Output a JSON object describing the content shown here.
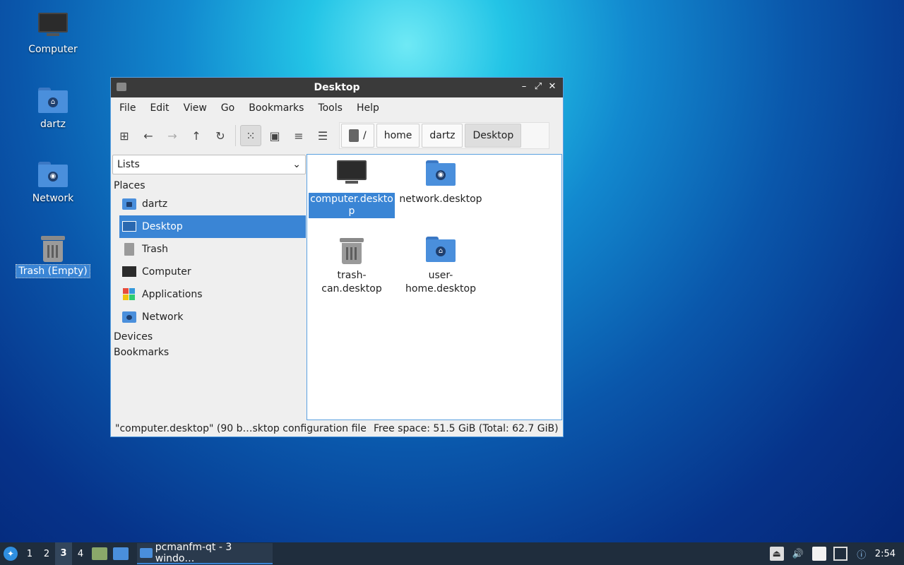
{
  "desktop": {
    "icons": [
      {
        "label": "Computer"
      },
      {
        "label": "dartz"
      },
      {
        "label": "Network"
      },
      {
        "label": "Trash (Empty)"
      }
    ]
  },
  "window": {
    "title": "Desktop",
    "buttons": {
      "minimize": "–",
      "maximize": "⤢",
      "close": "✕"
    }
  },
  "menubar": {
    "items": [
      "File",
      "Edit",
      "View",
      "Go",
      "Bookmarks",
      "Tools",
      "Help"
    ]
  },
  "toolbar": {
    "icons": [
      "new-tab-icon",
      "back-icon",
      "forward-icon",
      "up-icon",
      "reload-icon",
      "icon-view-icon",
      "thumbnail-view-icon",
      "compact-view-icon",
      "detailed-view-icon"
    ],
    "path": {
      "root": "/",
      "segments": [
        "home",
        "dartz",
        "Desktop"
      ]
    }
  },
  "sidepane": {
    "mode": "Lists",
    "places_header": "Places",
    "places": [
      {
        "label": "dartz"
      },
      {
        "label": "Desktop"
      },
      {
        "label": "Trash"
      },
      {
        "label": "Computer"
      },
      {
        "label": "Applications"
      },
      {
        "label": "Network"
      }
    ],
    "devices_header": "Devices",
    "bookmarks_header": "Bookmarks"
  },
  "files": [
    {
      "name": "computer.desktop",
      "selected": true
    },
    {
      "name": "network.desktop",
      "selected": false
    },
    {
      "name": "trash-can.desktop",
      "selected": false
    },
    {
      "name": "user-home.desktop",
      "selected": false
    }
  ],
  "file_labels": {
    "f0": "computer.deskto​p",
    "f1": "network.desktop",
    "f2a": "trash-",
    "f2b": "can.desktop",
    "f3a": "user-",
    "f3b": "home.desktop"
  },
  "statusbar": {
    "selection": "\"computer.desktop\" (90 b…sktop configuration file",
    "space": "Free space: 51.5 GiB (Total: 62.7 GiB)"
  },
  "taskbar": {
    "workspaces": [
      "1",
      "2",
      "3",
      "4"
    ],
    "current_workspace": "3",
    "task_label": "pcmanfm-qt - 3 windo…",
    "clock": "2:54"
  },
  "colors": {
    "accent": "#3a85d5",
    "titlebar": "#3a3a3a",
    "taskbar": "#1f2d3d",
    "folder": "#4a8fdc"
  }
}
